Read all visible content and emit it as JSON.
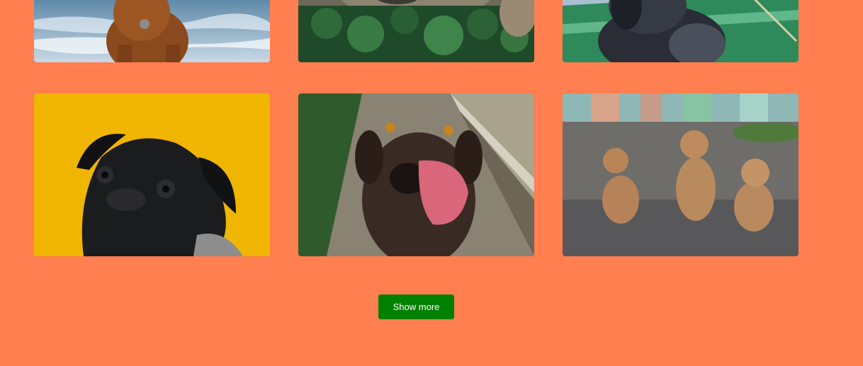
{
  "gallery": {
    "rows": [
      {
        "cards": [
          {
            "image": "dog-on-beach-photo"
          },
          {
            "image": "dog-in-leaves-photo"
          },
          {
            "image": "dog-in-boat-photo"
          }
        ]
      },
      {
        "cards": [
          {
            "image": "pug-yellow-background-photo"
          },
          {
            "image": "labrador-licking-photo"
          },
          {
            "image": "three-puppies-photo"
          }
        ]
      }
    ]
  },
  "actions": {
    "show_more_label": "Show more"
  },
  "colors": {
    "background": "#ff7f50",
    "button": "#008000",
    "button_text": "#ffffff"
  }
}
